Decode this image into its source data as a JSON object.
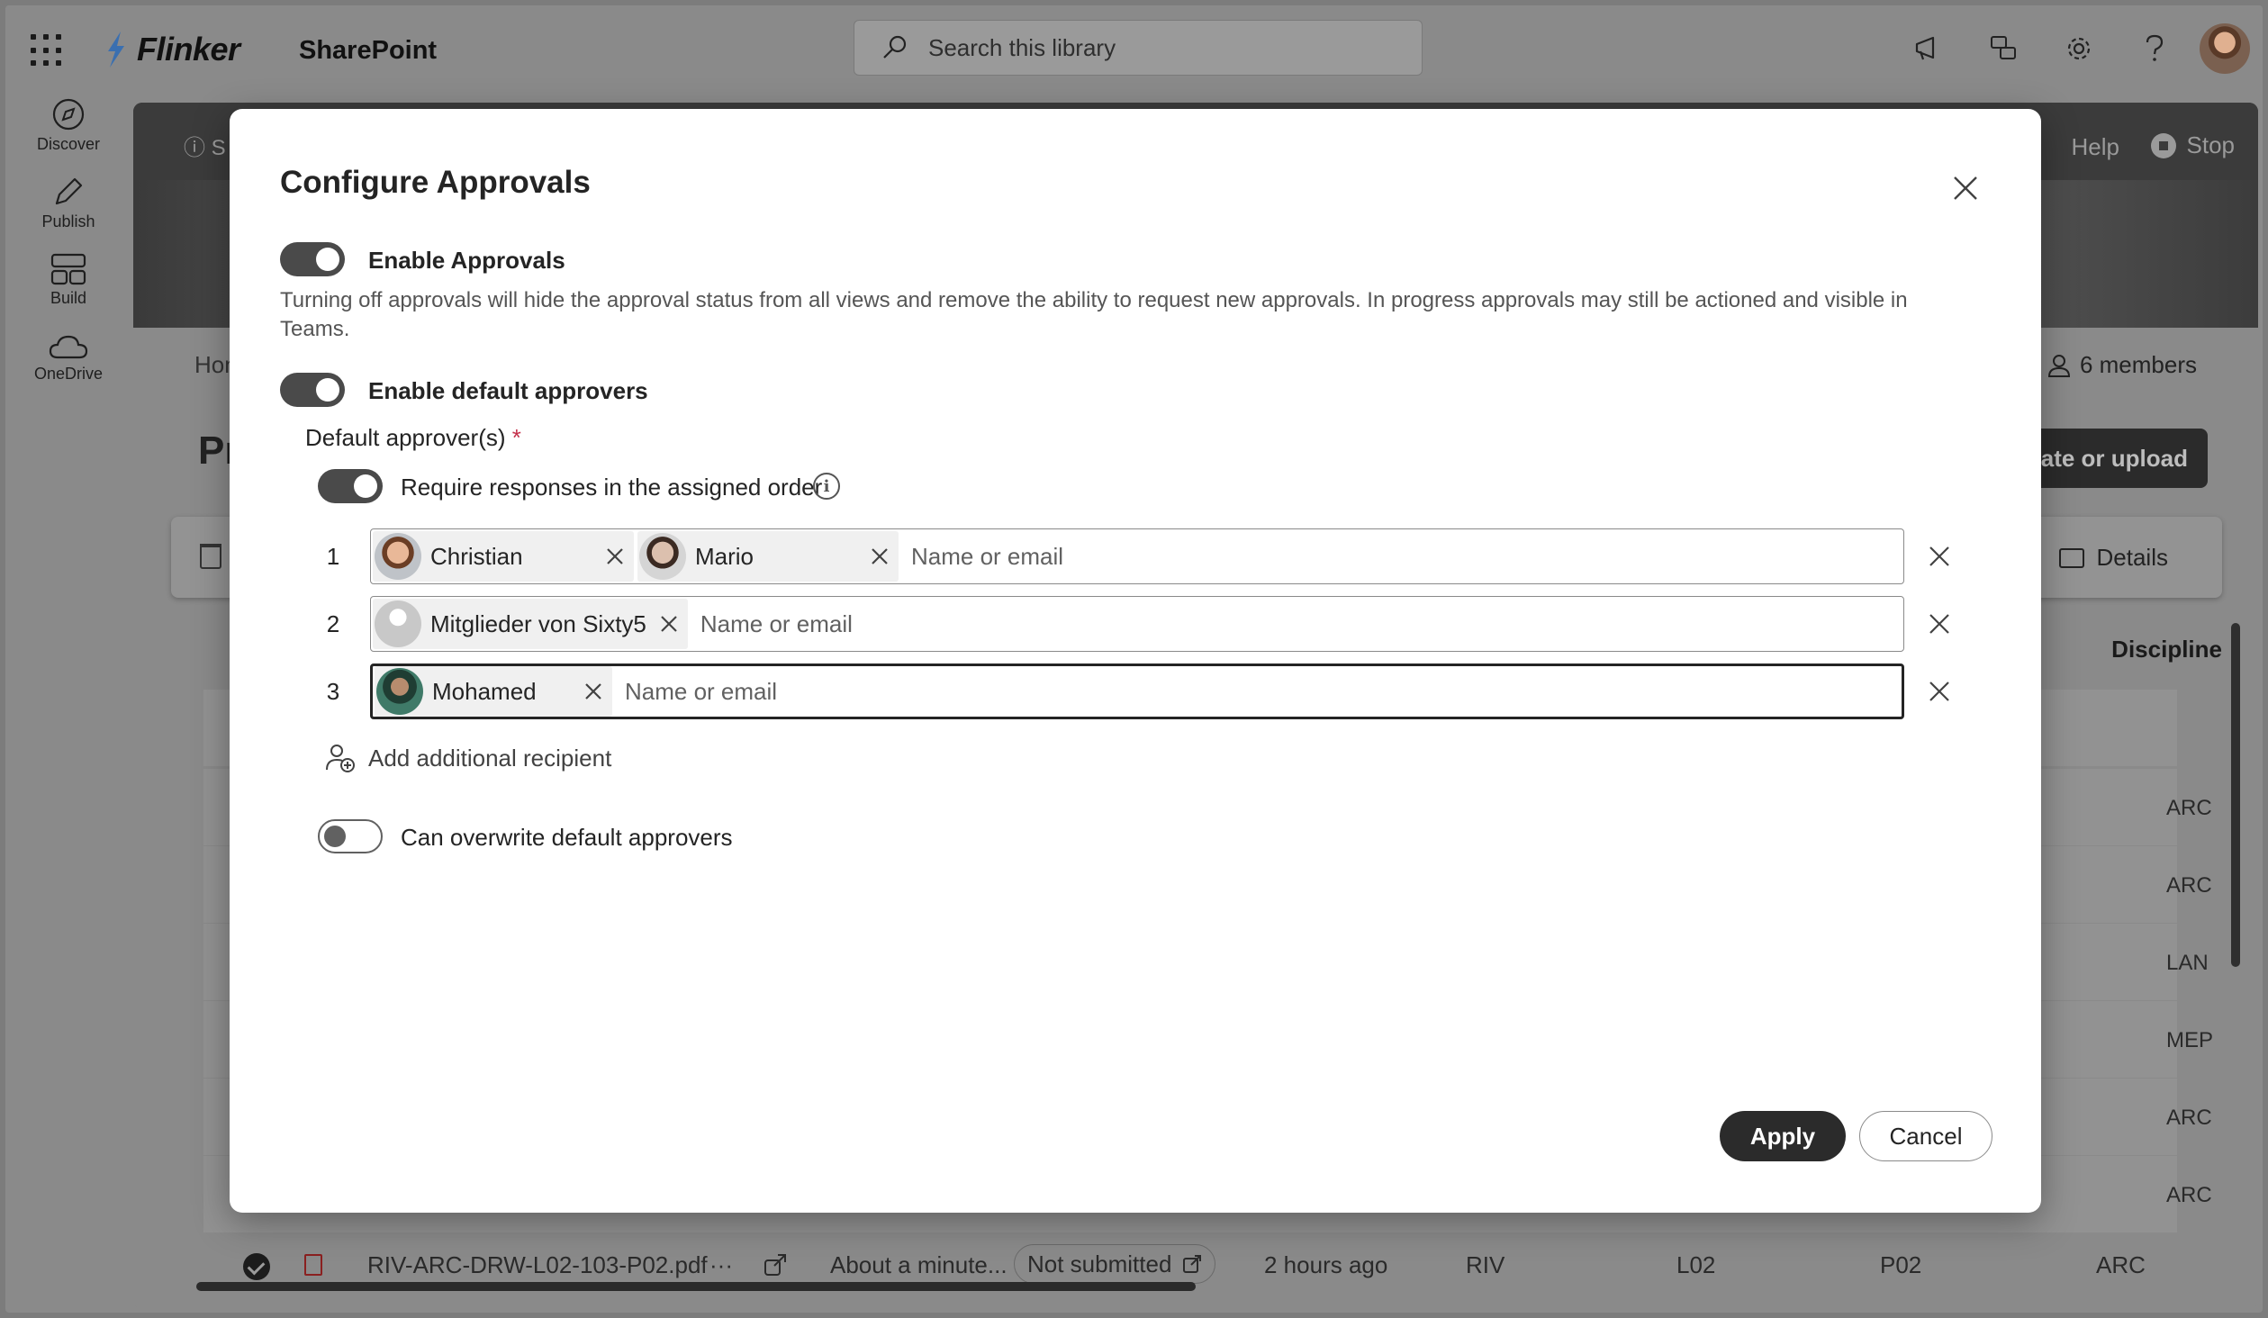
{
  "suite": {
    "brand": "Flinker",
    "app": "SharePoint",
    "search_placeholder": "Search this library",
    "icons": [
      "megaphone-icon",
      "feedback-icon",
      "settings-gear-icon",
      "help-question-icon",
      "user-avatar"
    ]
  },
  "rail": [
    {
      "label": "Discover",
      "icon": "compass-icon"
    },
    {
      "label": "Publish",
      "icon": "pen-icon"
    },
    {
      "label": "Build",
      "icon": "layout-icon"
    },
    {
      "label": "OneDrive",
      "icon": "cloud-icon"
    }
  ],
  "background": {
    "hero_info": "S",
    "help": "Help",
    "stop": "Stop",
    "breadcrumb": "Hon",
    "members": "6 members",
    "page_heading": "Pr",
    "create_button": "ate or upload",
    "details": "Details",
    "column_discipline": "Discipline",
    "disciplines": [
      "ARC",
      "ARC",
      "LAN",
      "MEP",
      "ARC",
      "ARC"
    ],
    "bottom_row": {
      "filename": "RIV-ARC-DRW-L02-103-P02.pdf",
      "more": "···",
      "modified_by": "About a minute...",
      "status": "Not submitted",
      "modified": "2 hours ago",
      "project": "RIV",
      "level": "L02",
      "revision": "P02",
      "discipline": "ARC"
    }
  },
  "dialog": {
    "title": "Configure Approvals",
    "enable_approvals": {
      "label": "Enable Approvals",
      "on": true
    },
    "description": "Turning off approvals will hide the approval status from all views and remove the ability to request new approvals. In progress approvals may still be actioned and visible in Teams.",
    "enable_default": {
      "label": "Enable default approvers",
      "on": true
    },
    "default_label": "Default approver(s)",
    "required_marker": "*",
    "require_order": {
      "label": "Require responses in the assigned order",
      "on": true
    },
    "input_placeholder": "Name or email",
    "rows": [
      {
        "num": "1",
        "people": [
          {
            "name": "Christian",
            "avatar": "#c58b62"
          },
          {
            "name": "Mario",
            "avatar": "#8a7466"
          }
        ]
      },
      {
        "num": "2",
        "people": [
          {
            "name": "Mitglieder von Sixty5",
            "avatar": "#c8c8c8"
          }
        ]
      },
      {
        "num": "3",
        "people": [
          {
            "name": "Mohamed",
            "avatar": "#2f5f55"
          }
        ]
      }
    ],
    "add_recipient": "Add additional recipient",
    "can_overwrite": {
      "label": "Can overwrite default approvers",
      "on": false
    },
    "apply": "Apply",
    "cancel": "Cancel"
  }
}
